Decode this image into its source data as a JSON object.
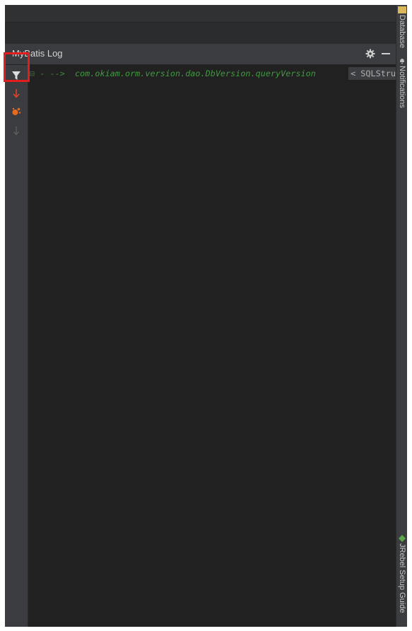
{
  "tool_window": {
    "title": "MyBatis Log",
    "settings_icon": "gear-icon",
    "minimize_icon": "minimize-icon"
  },
  "toolbar": {
    "items": [
      {
        "name": "filter",
        "icon": "filter-icon",
        "color": "#d9d9d9",
        "highlighted": true
      },
      {
        "name": "scroll-to-end",
        "icon": "arrow-down-icon",
        "color": "#e0412b"
      },
      {
        "name": "debug",
        "icon": "bug-icon",
        "color": "#e66b22"
      },
      {
        "name": "soft-wrap",
        "icon": "arrow-down-icon",
        "color": "#5c5c5c"
      }
    ]
  },
  "log": {
    "lines": [
      {
        "fold": "⊟",
        "prefix": "- -->",
        "method": "com.okiam.orm.version.dao.DbVersion.queryVersion",
        "sql_preview": "< SQLStru"
      }
    ]
  },
  "right_stripe": {
    "tabs": [
      {
        "label": "Database",
        "icon": "database-icon"
      },
      {
        "label": "Notifications",
        "icon": "bell-icon"
      },
      {
        "label": "JRebel Setup Guide",
        "icon": "jrebel-icon"
      }
    ]
  },
  "colors": {
    "accent_highlight": "#e11d1d",
    "log_green": "#3f9a3f",
    "background": "#212121"
  }
}
